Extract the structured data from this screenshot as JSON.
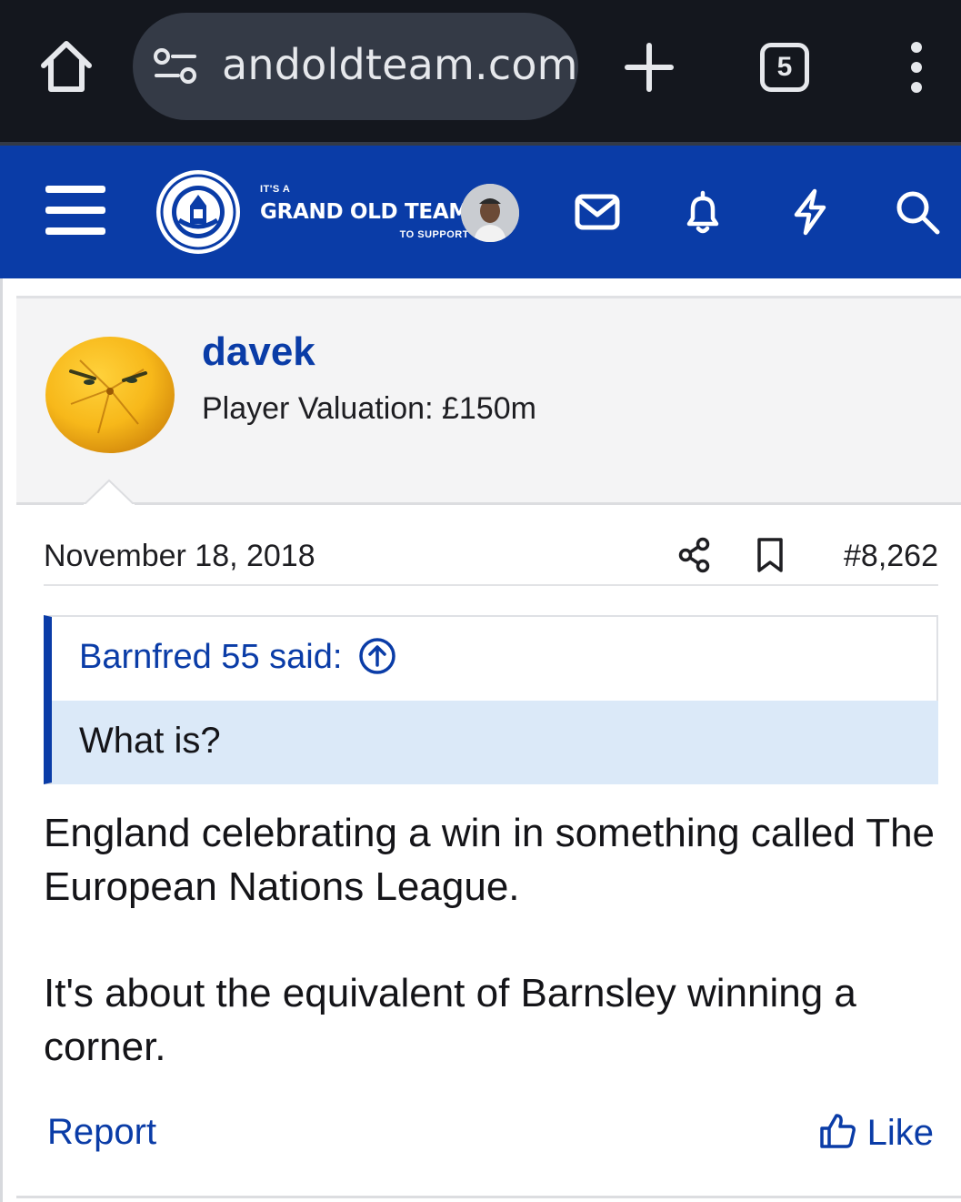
{
  "browser": {
    "url": "andoldteam.com",
    "tab_count": "5"
  },
  "site": {
    "logo_line1": "IT'S A",
    "logo_line2": "GRAND OLD TEAM",
    "logo_line3": "TO SUPPORT",
    "brand_color": "#0a3ca7"
  },
  "post": {
    "username": "davek",
    "user_title": "Player Valuation: £150m",
    "date": "November 18, 2018",
    "post_number": "#8,262",
    "quote": {
      "author": "Barnfred 55 said:",
      "text": "What is?"
    },
    "paragraphs": [
      "England celebrating a win in something called The European Nations League.",
      "It's about the equivalent of Barnsley winning a corner."
    ],
    "actions": {
      "report": "Report",
      "like": "Like"
    }
  }
}
